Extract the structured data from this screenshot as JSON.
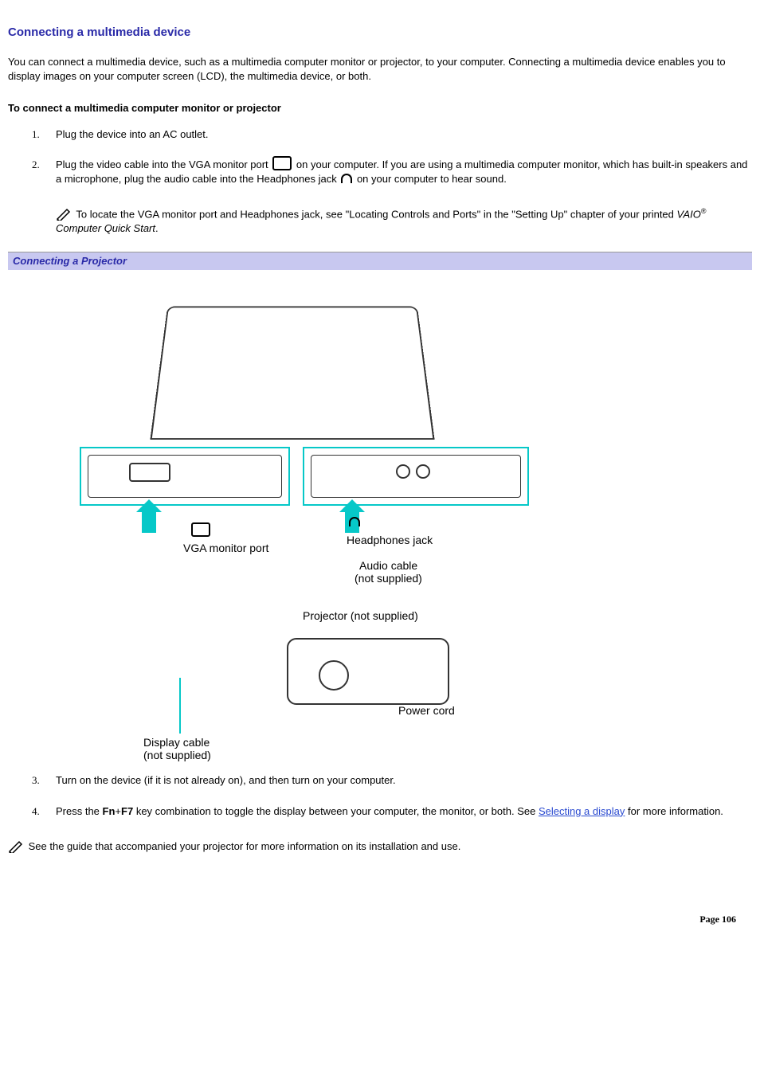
{
  "title": "Connecting a multimedia device",
  "intro": "You can connect a multimedia device, such as a multimedia computer monitor or projector, to your computer. Connecting a multimedia device enables you to display images on your computer screen (LCD), the multimedia device, or both.",
  "subhead": "To connect a multimedia computer monitor or projector",
  "steps": {
    "s1": "Plug the device into an AC outlet.",
    "s2a": "Plug the video cable into the VGA monitor port ",
    "s2b": " on your computer. If you are using a multimedia computer monitor, which has built-in speakers and a microphone, plug the audio cable into the Headphones jack ",
    "s2c": " on your computer to hear sound.",
    "s2_note_a": " To locate the VGA monitor port and Headphones jack, see \"Locating Controls and Ports\" in the \"Setting Up\" chapter of your printed ",
    "s2_note_em": "VAIO",
    "s2_note_reg": "®",
    "s2_note_em2": " Computer Quick Start",
    "s2_note_tail": ".",
    "s3": "Turn on the device (if it is not already on), and then turn on your computer.",
    "s4a": "Press the ",
    "s4_fn": "Fn",
    "s4_plus": "+",
    "s4_f7": "F7",
    "s4b": " key combination to toggle the display between your computer, the monitor, or both. See ",
    "s4_link": "Selecting a display",
    "s4c": " for more information."
  },
  "figure_title": "Connecting a Projector",
  "figure_labels": {
    "vga_port": "VGA monitor port",
    "headphones_jack": "Headphones jack",
    "audio_cable": "Audio cable",
    "audio_cable2": "(not supplied)",
    "projector": "Projector (not supplied)",
    "power_cord": "Power cord",
    "display_cable": "Display cable",
    "display_cable2": "(not supplied)"
  },
  "end_note": " See the guide that accompanied your projector for more information on its installation and use.",
  "page_number": "Page 106"
}
